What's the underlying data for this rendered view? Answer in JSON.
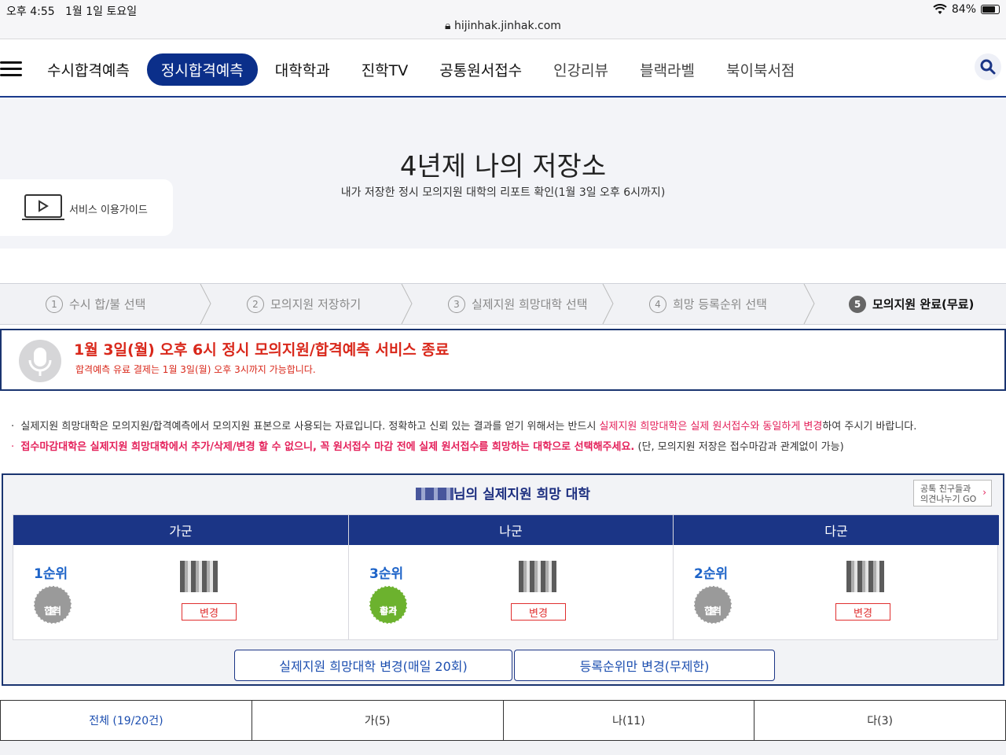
{
  "status": {
    "time": "오후 4:55",
    "date": "1월 1일 토요일",
    "battery": "84%",
    "battery_level": 0.84,
    "url": "hijinhak.jinhak.com"
  },
  "nav": {
    "items": [
      {
        "label": "수시합격예측",
        "active": false
      },
      {
        "label": "정시합격예측",
        "active": true
      },
      {
        "label": "대학학과",
        "active": false
      },
      {
        "label": "진학TV",
        "active": false
      },
      {
        "label": "공통원서접수",
        "active": false
      },
      {
        "label": "인강리뷰",
        "active": false
      },
      {
        "label": "블랙라벨",
        "active": false
      },
      {
        "label": "북이북서점",
        "active": false
      }
    ]
  },
  "hero": {
    "title": "4년제 나의 저장소",
    "subtitle": "내가 저장한 정시 모의지원 대학의 리포트 확인(1월 3일 오후 6시까지)",
    "guide_label": "서비스 이용가이드"
  },
  "steps": [
    {
      "num": "1",
      "label": "수시 합/불 선택"
    },
    {
      "num": "2",
      "label": "모의지원 저장하기"
    },
    {
      "num": "3",
      "label": "실제지원 희망대학 선택"
    },
    {
      "num": "4",
      "label": "희망 등록순위 선택"
    },
    {
      "num": "5",
      "label": "모의지원 완료(무료)"
    }
  ],
  "notice": {
    "headline": "1월 3일(월) 오후 6시 정시 모의지원/합격예측 서비스 종료",
    "sub": "합격예측 유료 결제는 1월 3일(월) 오후 3시까지 가능합니다."
  },
  "info": {
    "line1_a": "실제지원 희망대학은 모의지원/합격예측에서 모의지원 표본으로 사용되는 자료입니다. 정확하고 신뢰 있는 결과를 얻기 위해서는 반드시 ",
    "line1_b": "실제지원 희망대학은 실제 원서접수와 동일하게 변경",
    "line1_c": "하여 주시기 바랍니다.",
    "line2_a": "접수마감대학은 실제지원 희망대학에서 추가/삭제/변경 할 수 없으니, 꼭 원서접수 마감 전에 실제 원서접수를 희망하는 대학으로 선택해주세요.",
    "line2_b": " (단, 모의지원 저장은 접수마감과 관계없이 가능)"
  },
  "wish": {
    "title_suffix": "님의 실제지원 희망 대학",
    "friends_line1": "공톡 친구들과",
    "friends_line2": "의견나누기 GO",
    "groups": [
      {
        "name": "가군",
        "rank": "1순위",
        "seal_line1": "불",
        "seal_line2": "합격",
        "seal_color": "#9a9a9a",
        "change": "변경"
      },
      {
        "name": "나군",
        "rank": "3순위",
        "seal_line1": "추가",
        "seal_line2": "합격",
        "seal_color": "#6cb22e",
        "change": "변경"
      },
      {
        "name": "다군",
        "rank": "2순위",
        "seal_line1": "불",
        "seal_line2": "합격",
        "seal_color": "#9a9a9a",
        "change": "변경"
      }
    ],
    "btn_change_wish": "실제지원 희망대학 변경(매일 20회)",
    "btn_change_rank": "등록순위만 변경(무제한)"
  },
  "tabs": [
    {
      "label": "전체 (19/20건)",
      "active": true
    },
    {
      "label": "가(5)",
      "active": false
    },
    {
      "label": "나(11)",
      "active": false
    },
    {
      "label": "다(3)",
      "active": false
    }
  ],
  "colors": {
    "brand_navy": "#1b3586",
    "active_pill": "#0b2f8a",
    "alert_red": "#d9281b",
    "highlight_pink": "#e4205a"
  }
}
